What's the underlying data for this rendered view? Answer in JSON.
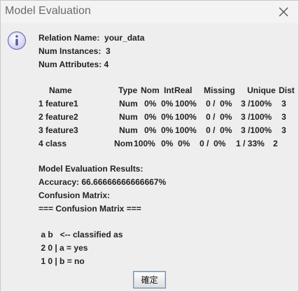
{
  "window": {
    "title": "Model Evaluation"
  },
  "relation": {
    "name_line": "Relation Name:  your_data",
    "instances_line": "Num Instances:  3",
    "attributes_line": "Num Attributes: 4"
  },
  "attr_table": {
    "headers": [
      "Name",
      "Type",
      "Nom",
      "Int",
      "Real",
      "Missing",
      "Unique",
      "Dist"
    ],
    "rows": [
      [
        "1 feature1",
        "Num",
        "0%",
        "0%",
        "100%",
        "0 /  0%",
        "3 /100%",
        "3"
      ],
      [
        "2 feature2",
        "Num",
        "0%",
        "0%",
        "100%",
        "0 /  0%",
        "3 /100%",
        "3"
      ],
      [
        "3 feature3",
        "Num",
        "0%",
        "0%",
        "100%",
        "0 /  0%",
        "3 /100%",
        "3"
      ],
      [
        "4 class",
        "Nom",
        "100%",
        "0%",
        "0%",
        "0 /  0%",
        "1 / 33%",
        "2"
      ]
    ]
  },
  "results": {
    "heading": "Model Evaluation Results:",
    "accuracy": "Accuracy: 66.66666666666667%",
    "confusion_label": "Confusion Matrix:",
    "confusion_title": "=== Confusion Matrix ===",
    "matrix_header": " a b   <-- classified as",
    "matrix_row_1": " 2 0 | a = yes",
    "matrix_row_2": " 1 0 | b = no"
  },
  "buttons": {
    "ok_label": "確定"
  },
  "icons": {
    "info": "info-icon",
    "close": "close-icon"
  },
  "colors": {
    "info_icon_fill": "#e6e6fa",
    "info_icon_stroke": "#6a6ab0"
  }
}
